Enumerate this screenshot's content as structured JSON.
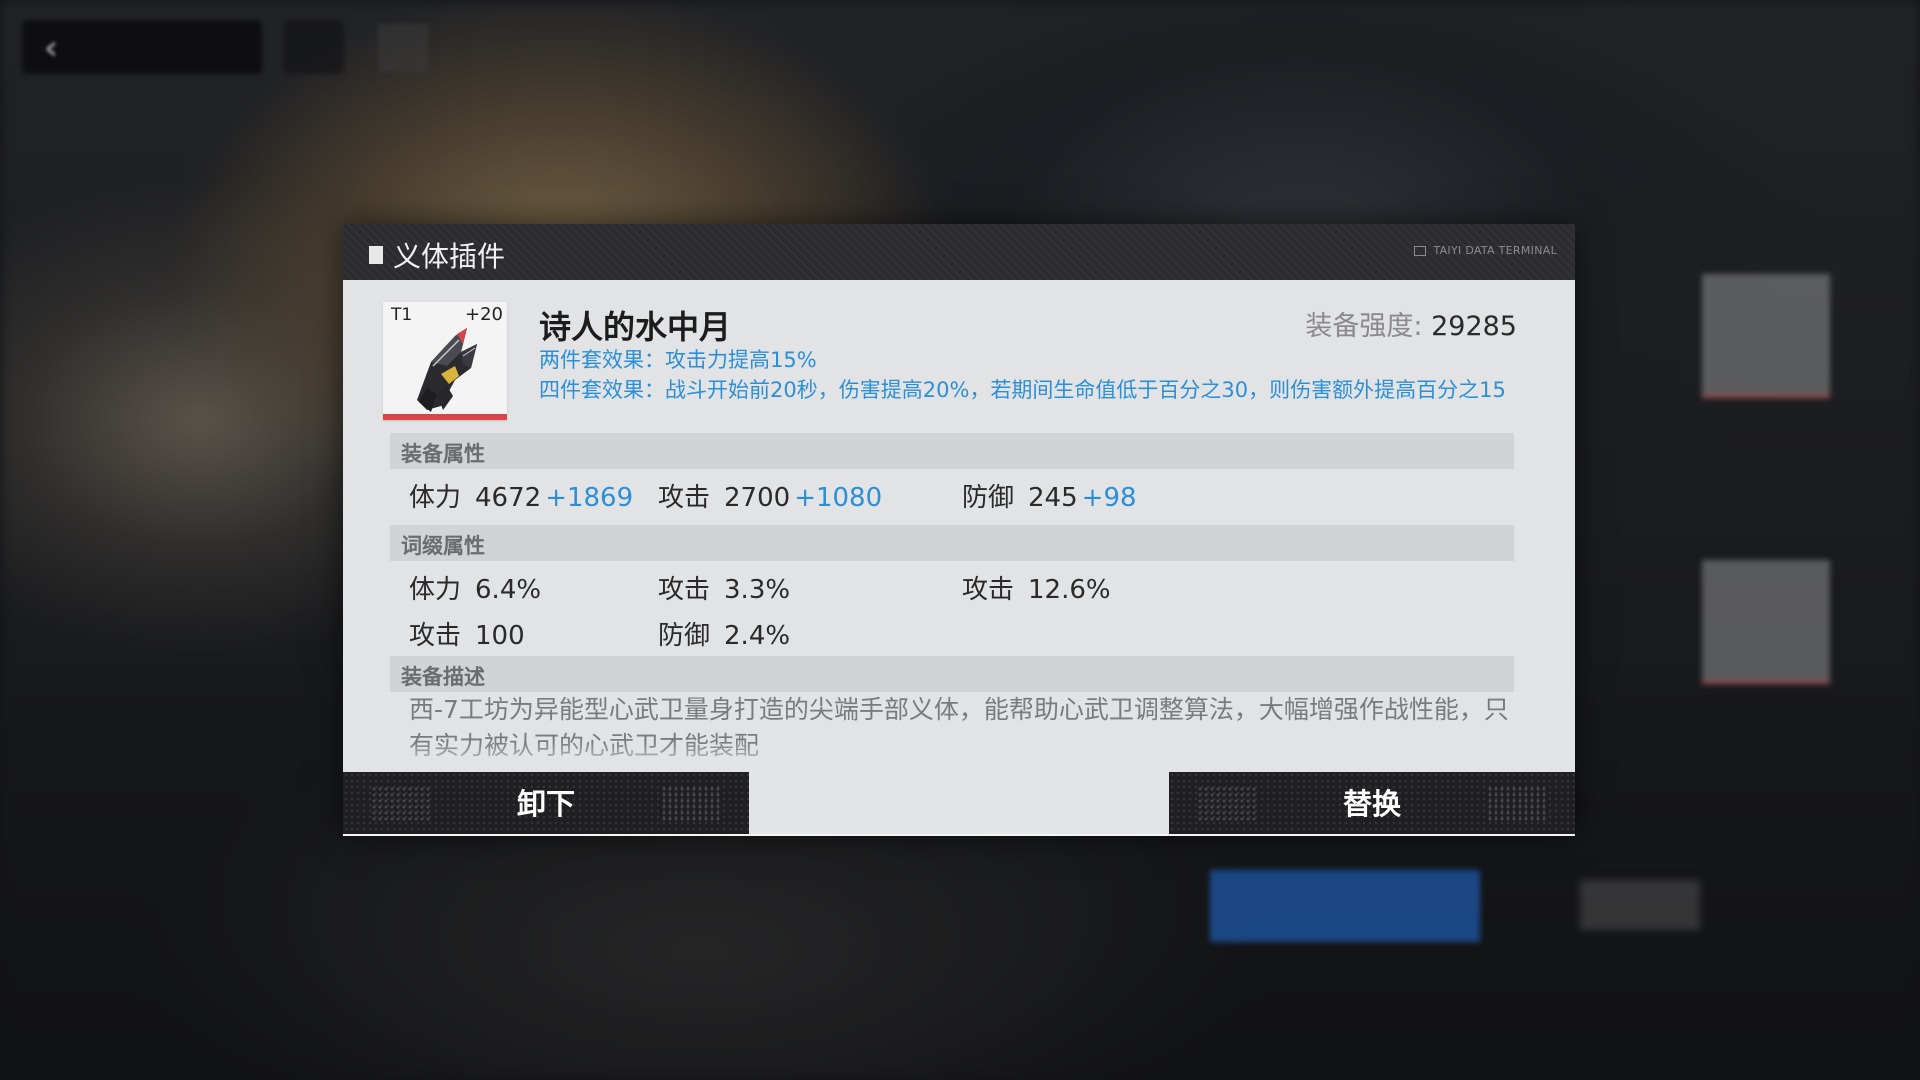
{
  "dialog": {
    "title": "义体插件",
    "tag": "TAIYI DATA TERMINAL",
    "item": {
      "tier": "T1",
      "level": "+20",
      "name": "诗人的水中月",
      "power_label": "装备强度:",
      "power_value": "29285",
      "set2": "两件套效果：攻击力提高15%",
      "set4": "四件套效果：战斗开始前20秒，伤害提高20%，若期间生命值低于百分之30，则伤害额外提高百分之15"
    },
    "base_stats": {
      "title": "装备属性",
      "items": [
        {
          "label": "体力",
          "value": "4672",
          "bonus": "+1869"
        },
        {
          "label": "攻击",
          "value": "2700",
          "bonus": "+1080"
        },
        {
          "label": "防御",
          "value": "245",
          "bonus": "+98"
        }
      ]
    },
    "affix_stats": {
      "title": "词缀属性",
      "items": [
        {
          "label": "体力",
          "value": "6.4%"
        },
        {
          "label": "攻击",
          "value": "3.3%"
        },
        {
          "label": "攻击",
          "value": "12.6%"
        },
        {
          "label": "攻击",
          "value": "100"
        },
        {
          "label": "防御",
          "value": "2.4%"
        }
      ]
    },
    "description": {
      "title": "装备描述",
      "text": "西-7工坊为异能型心武卫量身打造的尖端手部义体，能帮助心武卫调整算法，大幅增强作战性能，只有实力被认可的心武卫才能装配"
    },
    "buttons": {
      "unequip": "卸下",
      "replace": "替换"
    }
  },
  "colors": {
    "accent_blue": "#2c8fd6",
    "rarity_bar": "#d9454a",
    "header_bg": "#2c2c30",
    "button_bg": "#1f1f22"
  },
  "icons": {
    "item": "claw-gauntlet-icon",
    "back": "chevron-left-icon"
  }
}
